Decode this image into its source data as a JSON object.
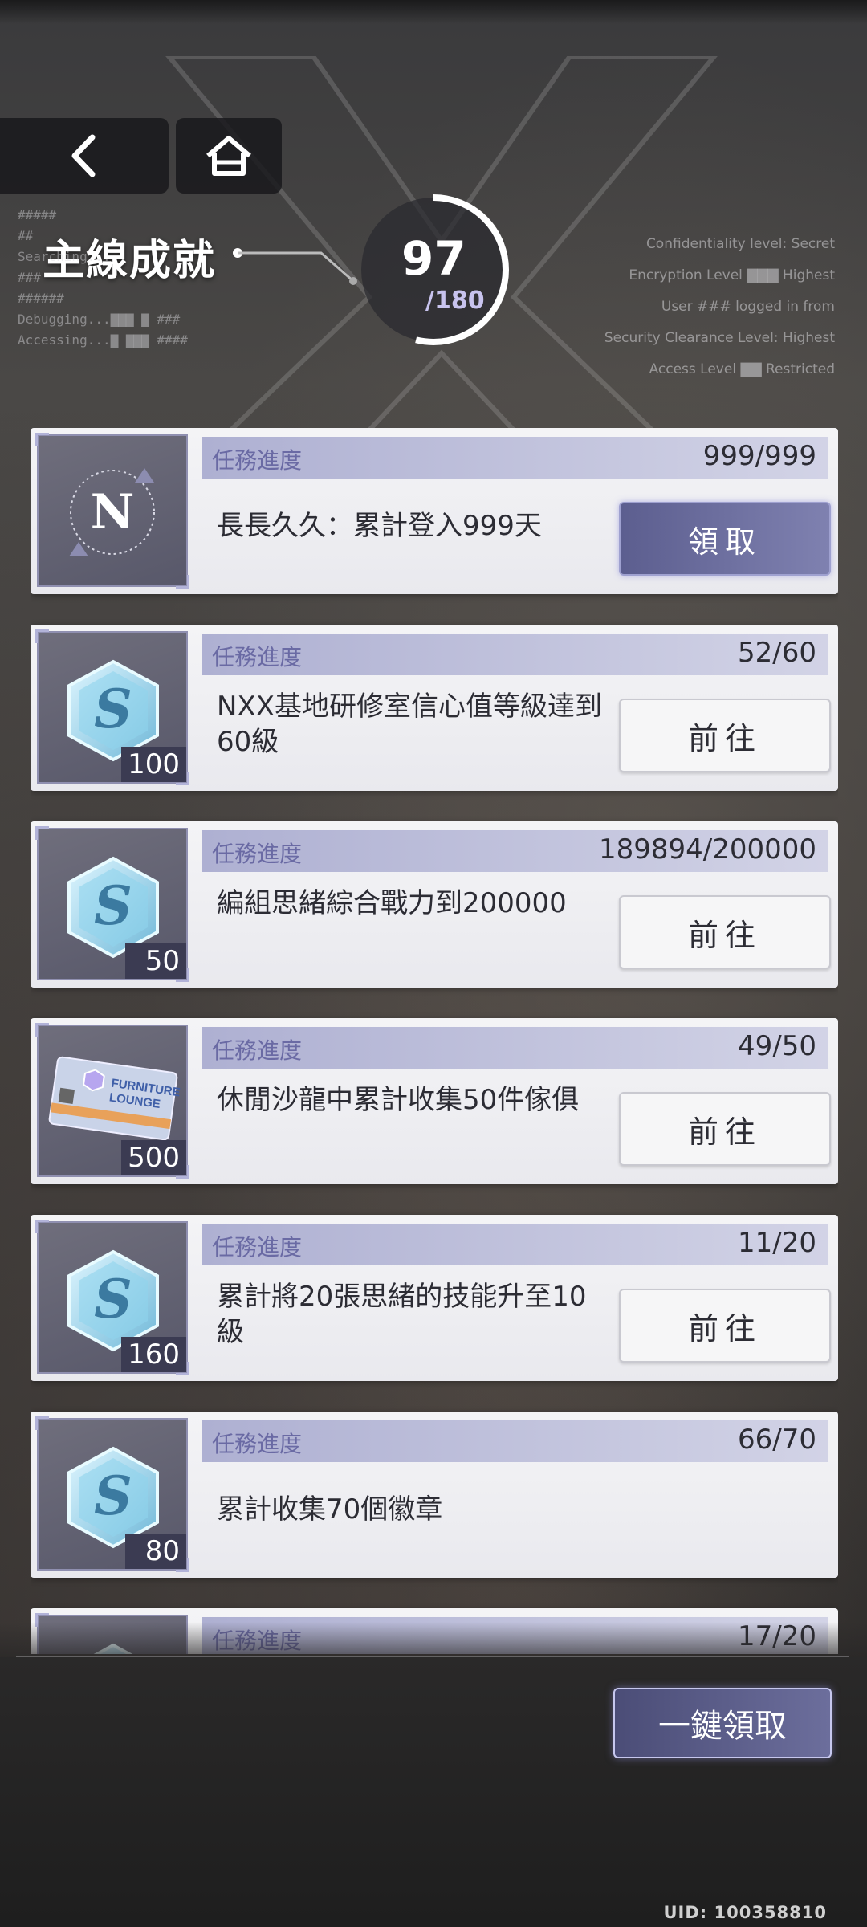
{
  "header": {
    "title": "主線成就",
    "progress_current": "97",
    "progress_total": "/180"
  },
  "deco_left": {
    "lines": [
      "#####",
      "##",
      "Searching...",
      "###",
      "######",
      "Debugging...▇▇▇ ▇  ###",
      "Accessing...▇ ▇▇▇  ####"
    ]
  },
  "deco_right": {
    "lines": [
      "Confidentiality level: Secret",
      "Encryption Level ▇▇▇ Highest",
      "User ### logged in from",
      "Security Clearance Level: Highest",
      "Access Level ▇▇ Restricted"
    ]
  },
  "progress_label": "任務進度",
  "tasks": [
    {
      "icon": "nxx-emblem-icon",
      "qty": "",
      "progress": "999/999",
      "desc": "長長久久：累計登入999天",
      "button": "領取",
      "button_type": "claim"
    },
    {
      "icon": "s-crystal-icon",
      "qty": "100",
      "progress": "52/60",
      "desc": "NXX基地研修室信心值等級達到60級",
      "button": "前往",
      "button_type": "go"
    },
    {
      "icon": "s-crystal-icon",
      "qty": "50",
      "progress": "189894/200000",
      "desc": "編組思緒綜合戰力到200000",
      "button": "前往",
      "button_type": "go"
    },
    {
      "icon": "furniture-lounge-ticket-icon",
      "qty": "500",
      "progress": "49/50",
      "desc": "休閒沙龍中累計收集50件傢俱",
      "button": "前往",
      "button_type": "go"
    },
    {
      "icon": "s-crystal-icon",
      "qty": "160",
      "progress": "11/20",
      "desc": "累計將20張思緒的技能升至10級",
      "button": "前往",
      "button_type": "go"
    },
    {
      "icon": "s-crystal-icon",
      "qty": "80",
      "progress": "66/70",
      "desc": "累計收集70個徽章",
      "button": "",
      "button_type": "none"
    },
    {
      "icon": "s-crystal-icon",
      "qty": "",
      "progress": "17/20",
      "desc": "",
      "button": "",
      "button_type": "none"
    }
  ],
  "footer": {
    "claim_all": "一鍵領取",
    "uid": "UID: 100358810"
  },
  "colors": {
    "accent": "#6c6e9c",
    "progress_label": "#6a6aa4",
    "ring": "#ffffff"
  }
}
